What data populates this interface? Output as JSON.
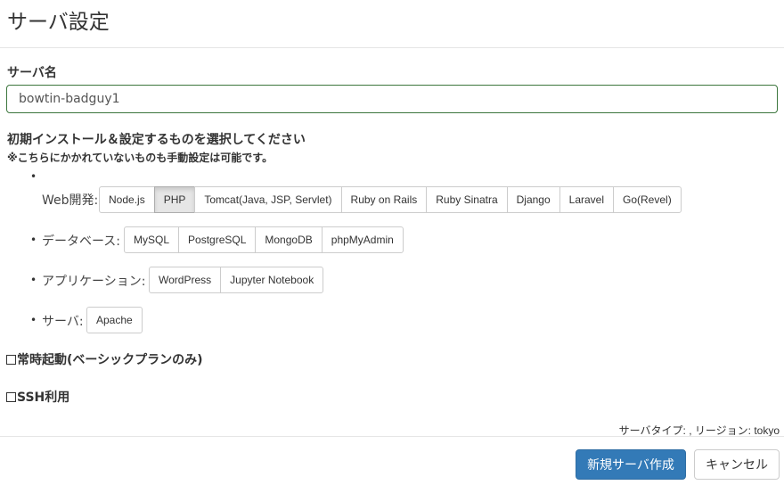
{
  "header": {
    "title": "サーバ設定"
  },
  "server_name": {
    "label": "サーバ名",
    "value": "bowtin-badguy1"
  },
  "install": {
    "heading": "初期インストール＆設定するものを選択してください",
    "note": "※こちらにかかれていないものも手動設定は可能です。",
    "bullet": "•",
    "categories": [
      {
        "label": "Web開発:",
        "options": [
          "Node.js",
          "PHP",
          "Tomcat(Java, JSP, Servlet)",
          "Ruby on Rails",
          "Ruby Sinatra",
          "Django",
          "Laravel",
          "Go(Revel)"
        ],
        "selected": "PHP"
      },
      {
        "label": "データベース:",
        "options": [
          "MySQL",
          "PostgreSQL",
          "MongoDB",
          "phpMyAdmin"
        ]
      },
      {
        "label": "アプリケーション:",
        "options": [
          "WordPress",
          "Jupyter Notebook"
        ]
      },
      {
        "label": "サーバ:",
        "options": [
          "Apache"
        ]
      }
    ]
  },
  "options": {
    "always_on": {
      "label": "常時起動(ベーシックプランのみ)",
      "checked": false
    },
    "ssh": {
      "label": "SSH利用",
      "checked": false
    }
  },
  "server_info": "サーバタイプ: , リージョン: tokyo",
  "footer": {
    "create_label": "新規サーバ作成",
    "cancel_label": "キャンセル"
  },
  "colors": {
    "primary": "#337ab7",
    "input_border": "#3c763d",
    "active_button": "#e6e6e6"
  }
}
